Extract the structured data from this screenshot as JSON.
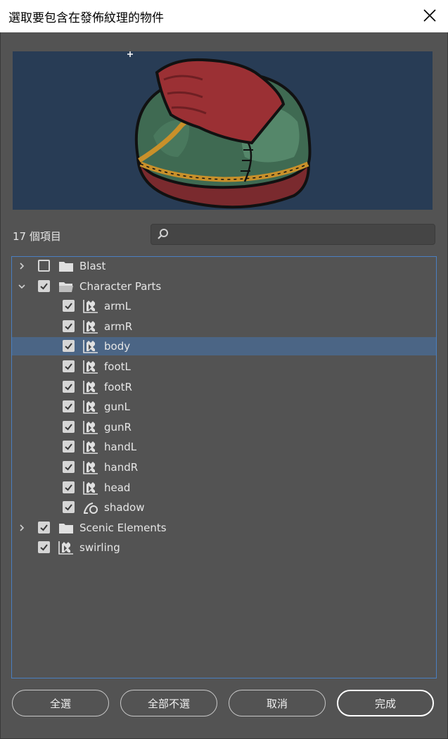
{
  "window": {
    "title": "選取要包含在發佈紋理的物件"
  },
  "summary": {
    "item_count": "17 個項目"
  },
  "search": {
    "value": "",
    "placeholder": ""
  },
  "tree": {
    "items": [
      {
        "label": "Blast",
        "type": "folder",
        "expanded": false,
        "checked": false,
        "level": 0
      },
      {
        "label": "Character Parts",
        "type": "folder",
        "expanded": true,
        "checked": true,
        "level": 0
      },
      {
        "label": "armL",
        "type": "symbol",
        "checked": true,
        "level": 1
      },
      {
        "label": "armR",
        "type": "symbol",
        "checked": true,
        "level": 1
      },
      {
        "label": "body",
        "type": "symbol",
        "checked": true,
        "level": 1,
        "selected": true
      },
      {
        "label": "footL",
        "type": "symbol",
        "checked": true,
        "level": 1
      },
      {
        "label": "footR",
        "type": "symbol",
        "checked": true,
        "level": 1
      },
      {
        "label": "gunL",
        "type": "symbol",
        "checked": true,
        "level": 1
      },
      {
        "label": "gunR",
        "type": "symbol",
        "checked": true,
        "level": 1
      },
      {
        "label": "handL",
        "type": "symbol",
        "checked": true,
        "level": 1
      },
      {
        "label": "handR",
        "type": "symbol",
        "checked": true,
        "level": 1
      },
      {
        "label": "head",
        "type": "symbol",
        "checked": true,
        "level": 1
      },
      {
        "label": "shadow",
        "type": "shape",
        "checked": true,
        "level": 1
      },
      {
        "label": "Scenic Elements",
        "type": "folder",
        "expanded": false,
        "checked": true,
        "level": 0
      },
      {
        "label": "swirling",
        "type": "symbol",
        "checked": true,
        "level": 0
      }
    ]
  },
  "buttons": {
    "select_all": "全選",
    "deselect_all": "全部不選",
    "cancel": "取消",
    "done": "完成"
  },
  "colors": {
    "background": "#535353",
    "preview_bg": "#283c55",
    "selection": "#4b6585",
    "tree_border": "#4a7fc1"
  }
}
